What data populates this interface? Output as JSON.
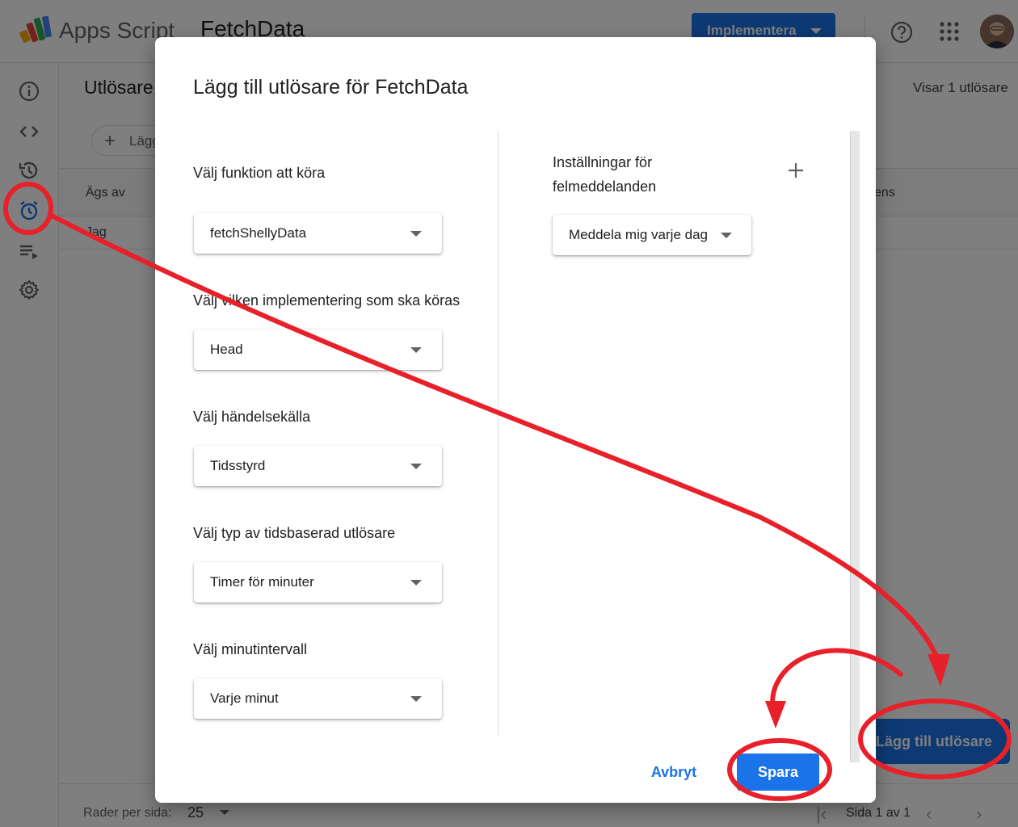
{
  "app": {
    "name": "Apps Script",
    "project": "FetchData",
    "deploy_label": "Implementera"
  },
  "page": {
    "title": "Utlösare",
    "showing": "Visar 1 utlösare",
    "add_button_partial": "Lägg",
    "table": {
      "headers": [
        "Ägs av",
        "ens"
      ],
      "row_cell": "Jag"
    },
    "footer": {
      "rows_per_page_label": "Rader per sida:",
      "rows_per_page_value": "25",
      "page_info": "Sida 1 av 1"
    },
    "add_trigger_button": "Lägg till utlösare"
  },
  "dialog": {
    "title": "Lägg till utlösare för FetchData",
    "fields": [
      {
        "label": "Välj funktion att köra",
        "value": "fetchShellyData"
      },
      {
        "label": "Välj vilken implementering som ska köras",
        "value": "Head"
      },
      {
        "label": "Välj händelsekälla",
        "value": "Tidsstyrd"
      },
      {
        "label": "Välj typ av tidsbaserad utlösare",
        "value": "Timer för minuter"
      },
      {
        "label": "Välj minutintervall",
        "value": "Varje minut"
      }
    ],
    "error_settings": {
      "label": "Inställningar för felmeddelanden",
      "value": "Meddela mig varje dag"
    },
    "cancel_label": "Avbryt",
    "save_label": "Spara"
  },
  "colors": {
    "accent": "#1a73e8",
    "annotation": "#e8202a"
  },
  "icons": [
    "info-icon",
    "code-icon",
    "history-icon",
    "alarm-clock-icon",
    "executions-icon",
    "settings-gear-icon",
    "help-icon",
    "apps-grid-icon",
    "plus-icon"
  ]
}
